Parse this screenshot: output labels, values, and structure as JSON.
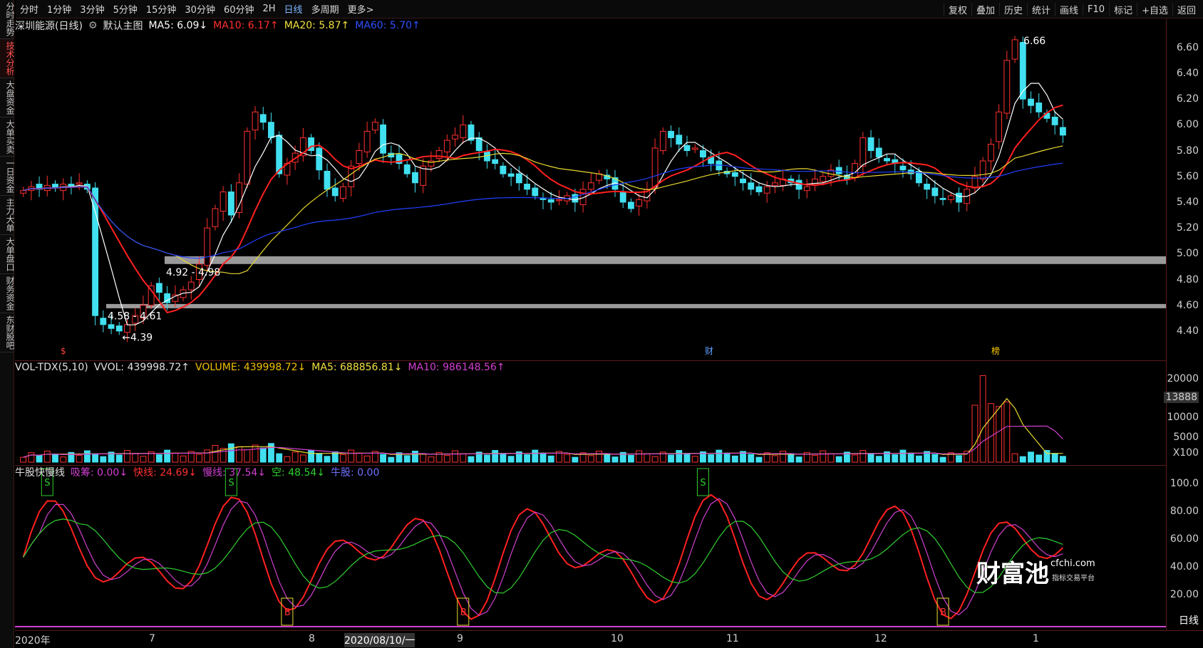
{
  "toolbar": {
    "items": [
      "分时",
      "1分钟",
      "3分钟",
      "5分钟",
      "15分钟",
      "30分钟",
      "60分钟",
      "2H",
      "日线",
      "多周期",
      "更多>"
    ],
    "right_items": [
      "复权",
      "叠加",
      "历史",
      "统计",
      "画线",
      "F10",
      "标记",
      "+自选",
      "返回"
    ]
  },
  "sidebar": {
    "tabs": [
      "分时走势",
      "技术分析",
      "大盘资金",
      "大单买卖",
      "一日资金",
      "主力大单",
      "大单盘口",
      "财务资金",
      "东财股吧"
    ],
    "active": 1
  },
  "main": {
    "stock_title": "深圳能源(日线)",
    "indicator_name": "默认主图",
    "ma5": "MA5: 6.09↓",
    "ma10": "MA10: 6.17↑",
    "ma20": "MA20: 5.87↑",
    "ma60": "MA60: 5.70↑",
    "high_label": "6.66",
    "low_label": "4.39",
    "zone1": "4.92 - 4.98",
    "zone2": "4.58 - 4.61",
    "marker_cai": "财",
    "marker_bang": "榜",
    "marker_s": "$"
  },
  "volume": {
    "title": "VOL-TDX(5,10)",
    "vvol": "VVOL: 439998.72↑",
    "volume": "VOLUME: 439998.72↓",
    "ma5": "MA5: 688856.81↓",
    "ma10": "MA10: 986148.56↑",
    "axis_labels": [
      "20000",
      "13888",
      "10000",
      "5000",
      "X100"
    ]
  },
  "indicator": {
    "title": "牛股快慢线",
    "xichou": "吸筹: 0.00↓",
    "kuai": "快线: 24.69↓",
    "man": "慢线: 37.54↓",
    "kong": "空: 48.54↓",
    "niugu": "牛股: 0.00",
    "axis_labels": [
      "100.0",
      "80.00",
      "60.00",
      "40.00",
      "20.00"
    ],
    "signal_b": "B",
    "signal_s": "S"
  },
  "price_axis": [
    "6.60",
    "6.40",
    "6.20",
    "6.00",
    "5.80",
    "5.60",
    "5.40",
    "5.20",
    "5.00",
    "4.80",
    "4.60",
    "4.40"
  ],
  "x_axis": [
    "2020年",
    "7",
    "8",
    "2020/08/10/一",
    "9",
    "10",
    "11",
    "12",
    "1"
  ],
  "period_label": "日线",
  "watermark": {
    "brand": "财富池",
    "site": "cfchi.com",
    "tagline": "指标交易平台"
  },
  "chart_data": {
    "type": "candlestick",
    "price_range": [
      4.3,
      6.72
    ],
    "closes": [
      5.49,
      5.52,
      5.5,
      5.53,
      5.51,
      5.54,
      5.52,
      5.55,
      5.5,
      4.52,
      4.45,
      4.42,
      4.4,
      4.45,
      4.52,
      4.6,
      4.75,
      4.7,
      4.62,
      4.68,
      4.72,
      4.78,
      4.92,
      5.2,
      5.35,
      5.48,
      5.3,
      5.55,
      5.95,
      6.1,
      6.02,
      5.9,
      5.62,
      5.7,
      5.78,
      5.9,
      5.8,
      5.65,
      5.5,
      5.45,
      5.52,
      5.68,
      5.8,
      5.95,
      6.02,
      5.78,
      5.75,
      5.7,
      5.62,
      5.55,
      5.68,
      5.72,
      5.8,
      5.88,
      5.92,
      6.0,
      5.88,
      5.8,
      5.72,
      5.7,
      5.62,
      5.6,
      5.55,
      5.5,
      5.45,
      5.42,
      5.4,
      5.42,
      5.45,
      5.4,
      5.5,
      5.55,
      5.62,
      5.58,
      5.5,
      5.4,
      5.35,
      5.42,
      5.5,
      5.82,
      5.95,
      5.9,
      5.85,
      5.8,
      5.82,
      5.75,
      5.7,
      5.65,
      5.62,
      5.6,
      5.55,
      5.5,
      5.48,
      5.52,
      5.55,
      5.58,
      5.55,
      5.5,
      5.52,
      5.58,
      5.6,
      5.65,
      5.62,
      5.58,
      5.7,
      5.9,
      5.8,
      5.75,
      5.72,
      5.7,
      5.65,
      5.62,
      5.55,
      5.5,
      5.45,
      5.42,
      5.45,
      5.4,
      5.5,
      5.6,
      5.72,
      5.85,
      6.1,
      6.5,
      6.66,
      6.2,
      6.15,
      6.1,
      6.05,
      6.0,
      5.92
    ]
  }
}
